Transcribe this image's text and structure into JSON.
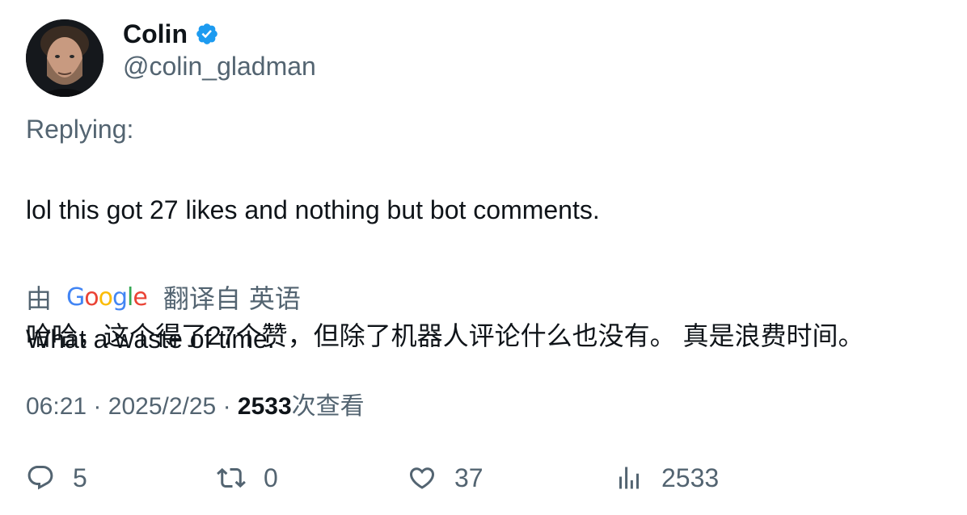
{
  "author": {
    "display_name": "Colin",
    "handle": "@colin_gladman",
    "verified": true,
    "verified_color": "#1d9bf0"
  },
  "replying_label": "Replying:",
  "tweet": {
    "line1": "lol this got 27 likes and nothing but bot comments.",
    "line2": "What a waste of time."
  },
  "translation": {
    "by_label": "由",
    "provider": "Google",
    "from_label": "翻译自",
    "language": "英语",
    "text": "哈哈，这个得了27个赞，但除了机器人评论什么也没有。 真是浪费时间。"
  },
  "meta": {
    "time": "06:21",
    "separator": "·",
    "date": "2025/2/25",
    "views_count": "2533",
    "views_label": "次查看"
  },
  "actions": {
    "reply_count": "5",
    "retweet_count": "0",
    "like_count": "37",
    "views_count": "2533"
  },
  "icons": {
    "reply": "reply-icon",
    "retweet": "retweet-icon",
    "like": "heart-icon",
    "views": "bar-chart-icon",
    "verified": "verified-badge-icon"
  },
  "colors": {
    "text_primary": "#0f1419",
    "text_secondary": "#536471",
    "accent": "#1d9bf0"
  }
}
